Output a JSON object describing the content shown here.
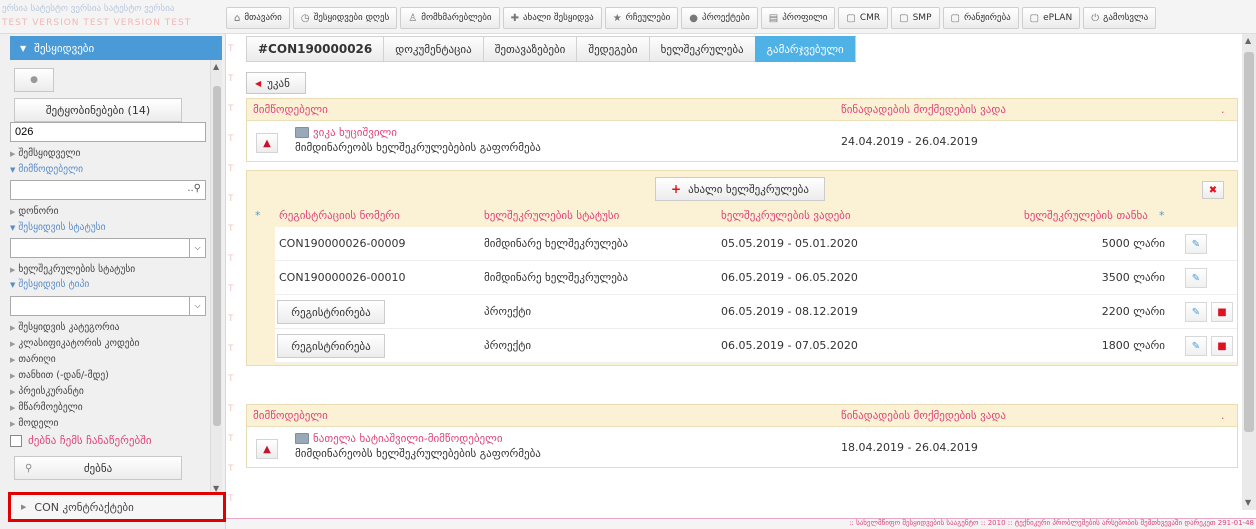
{
  "brand": {
    "line1": "ერსია სატესტო ვერსია სატესტო ვერსია",
    "line2": "TEST VERSION TEST VERSION TEST"
  },
  "topnav": [
    {
      "label": "მთავარი",
      "icon": "home-icon",
      "glyph": "⌂"
    },
    {
      "label": "შესყიდვები დღეს",
      "icon": "clock-icon",
      "glyph": "◷"
    },
    {
      "label": "მომხმარებლები",
      "icon": "users-icon",
      "glyph": "♙"
    },
    {
      "label": "ახალი შესყიდვა",
      "icon": "plus-circle-icon",
      "glyph": "✚"
    },
    {
      "label": "რჩეულები",
      "icon": "star-icon",
      "glyph": "★"
    },
    {
      "label": "პროექტები",
      "icon": "dot-icon",
      "glyph": "●"
    },
    {
      "label": "პროფილი",
      "icon": "profile-icon",
      "glyph": "▤"
    },
    {
      "label": "CMR",
      "icon": "doc-icon",
      "glyph": "▢"
    },
    {
      "label": "SMP",
      "icon": "doc-icon",
      "glyph": "▢"
    },
    {
      "label": "რანჟირება",
      "icon": "doc-icon",
      "glyph": "▢"
    },
    {
      "label": "ePLAN",
      "icon": "doc-icon",
      "glyph": "▢"
    },
    {
      "label": "გამოსვლა",
      "icon": "power-icon",
      "glyph": "⏻"
    }
  ],
  "sidebar": {
    "header": "შესყიდვები",
    "messages_btn": "შეტყობინებები (14)",
    "search_value": "026",
    "filters": {
      "buyer": "შემსყიდველი",
      "supplier": "მიმწოდებელი",
      "donor": "დონორი",
      "procurement_status": "შესყიდვის სტატუსი",
      "contract_status": "ხელშეკრულების სტატუსი",
      "procurement_type": "შესყიდვის ტიპი",
      "procurement_category": "შესყიდვის კატეგორია",
      "classifier_code": "კლასიფიკატორის კოდები",
      "date": "თარიღი",
      "amount": "თანხით (-დან/-მდე)",
      "pre_contract": "პრეისკურანტი",
      "manufacturer": "მწარმოებელი",
      "model": "მოდელი"
    },
    "my_records": "ძებნა ჩემს ჩანაწერებში",
    "search_btn": "ძებნა",
    "bottom_item": "CON კონტრაქტები"
  },
  "content": {
    "tabs": [
      {
        "label": "#CON190000026"
      },
      {
        "label": "დოკუმენტაცია"
      },
      {
        "label": "შეთავაზებები"
      },
      {
        "label": "შედეგები"
      },
      {
        "label": "ხელშეკრულება"
      },
      {
        "label": "გამარჯვებული"
      }
    ],
    "back_btn": "უკან",
    "panel1": {
      "col_supplier": "მიმწოდებელი",
      "col_validity": "წინადადების მოქმედების ვადა",
      "col_dot": ".",
      "supplier_name": "ვიკა ხუციშვილი",
      "supplier_status": "მიმდინარეობს ხელშეკრულებების გაფორმება",
      "validity": "24.04.2019 - 26.04.2019"
    },
    "contracts": {
      "new_btn": "ახალი ხელშეკრულება",
      "headers": {
        "star": "*",
        "reg_no": "რეგისტრაციის ნომერი",
        "status": "ხელშეკრულების სტატუსი",
        "term": "ხელშეკრულების ვადები",
        "amount": "ხელშეკრულების თანხა",
        "star2": "*"
      },
      "rows": [
        {
          "reg": "CON190000026-00009",
          "status": "მიმდინარე ხელშეკრულება",
          "term": "05.05.2019 - 05.01.2020",
          "amount": "5000 ლარი"
        },
        {
          "reg": "CON190000026-00010",
          "status": "მიმდინარე ხელშეკრულება",
          "term": "06.05.2019 - 06.05.2020",
          "amount": "3500 ლარი"
        },
        {
          "reg_btn": "რეგისტრირება",
          "status": "პროექტი",
          "term": "06.05.2019 - 08.12.2019",
          "amount": "2200 ლარი"
        },
        {
          "reg_btn": "რეგისტრირება",
          "status": "პროექტი",
          "term": "06.05.2019 - 07.05.2020",
          "amount": "1800 ლარი"
        }
      ]
    },
    "panel2": {
      "col_supplier": "მიმწოდებელი",
      "col_validity": "წინადადების მოქმედების ვადა",
      "col_dot": ".",
      "supplier_name": "ნათელა ხატიაშვილი-მიმწოდებელი",
      "supplier_status": "მიმდინარეობს ხელშეკრულებების გაფორმება",
      "validity": "18.04.2019 - 26.04.2019"
    }
  },
  "footer": ":: სახელმწიფო შესყიდვების სააგენტო :: 2010 :: ტექნიკური პრობლემების არსებობის შემთხვევაში დარეკეთ 291-01-48",
  "colors": {
    "accent": "#4fb2e6",
    "label_pink": "#e0457b",
    "panel_bg": "#fbf1d4",
    "highlight_red": "#e00000"
  }
}
